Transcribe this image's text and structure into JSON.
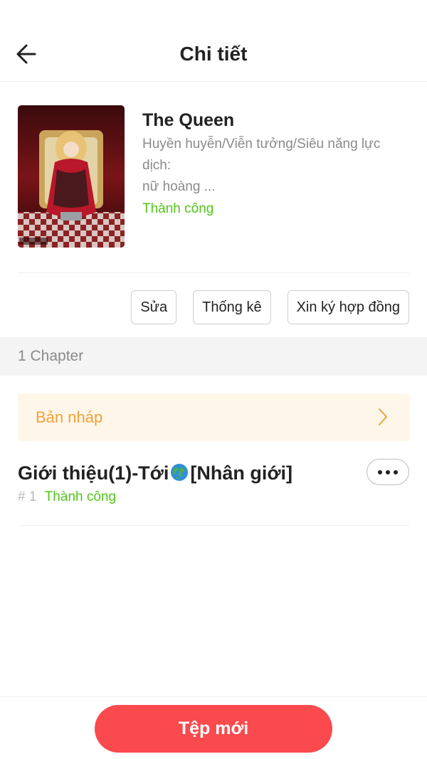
{
  "header": {
    "title": "Chi tiết",
    "back_icon": "arrow-left-icon"
  },
  "book": {
    "title": "The Queen",
    "genre": "Huyền huyễn/Viễn tưởng/Siêu năng lực",
    "description_label": "dịch:",
    "description": "nữ hoàng ...",
    "status": "Thành công",
    "status_color": "#52c41a"
  },
  "actions": {
    "edit_label": "Sửa",
    "stats_label": "Thống kê",
    "contract_label": "Xin ký hợp đồng"
  },
  "chapters": {
    "count_label": "1 Chapter",
    "draft_label": "Bản nháp",
    "draft_icon": "chevron-right-icon",
    "items": [
      {
        "title_before": "Giới thiệu(1)-Tới",
        "title_icon": "globe-icon",
        "title_after": "[Nhân giới]",
        "number": "# 1",
        "status": "Thành công",
        "more_icon": "more-dots-icon"
      }
    ]
  },
  "footer": {
    "new_label": "Tệp mới",
    "accent_color": "#fa4a4e"
  }
}
